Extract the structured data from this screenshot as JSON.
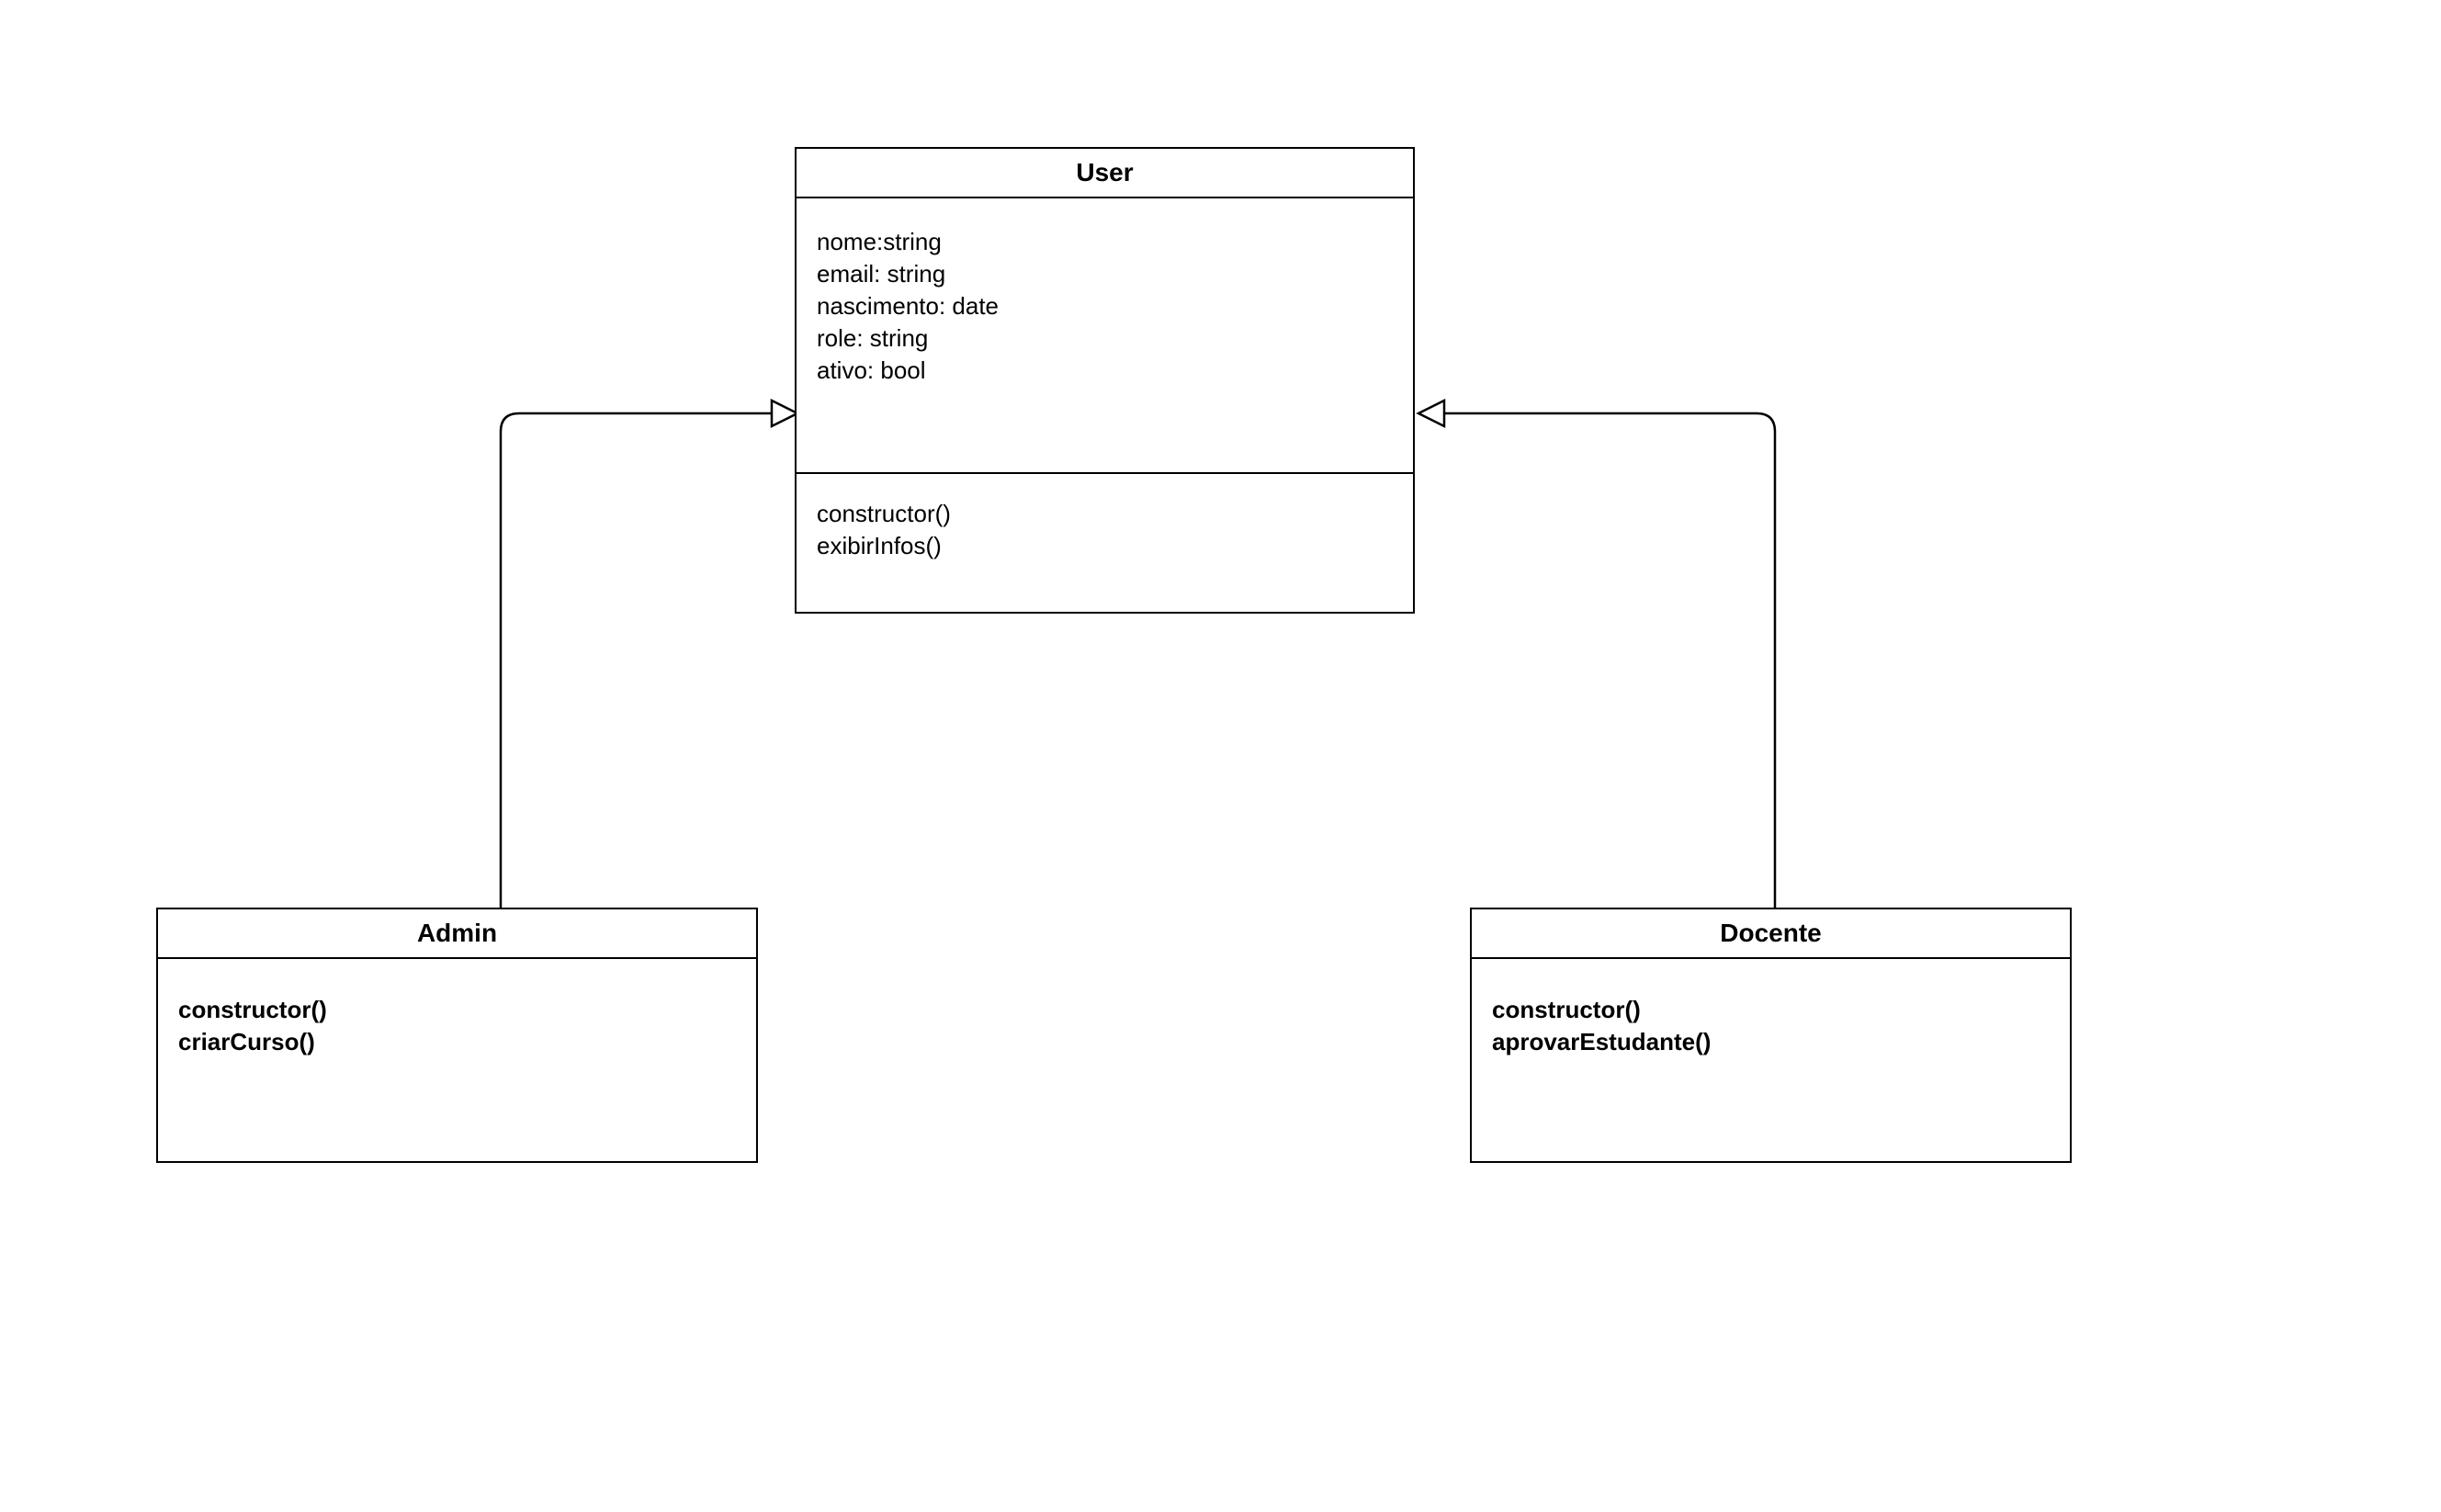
{
  "diagram": {
    "type": "uml-class-diagram",
    "classes": {
      "user": {
        "name": "User",
        "attributes": [
          "nome:string",
          "email: string",
          "nascimento: date",
          "role: string",
          "ativo: bool"
        ],
        "methods": [
          "constructor()",
          "exibirInfos()"
        ]
      },
      "admin": {
        "name": "Admin",
        "attributes": [],
        "methods": [
          "constructor()",
          "criarCurso()"
        ]
      },
      "docente": {
        "name": "Docente",
        "attributes": [],
        "methods": [
          "constructor()",
          "aprovarEstudante()"
        ]
      }
    },
    "relationships": [
      {
        "from": "admin",
        "to": "user",
        "type": "generalization"
      },
      {
        "from": "docente",
        "to": "user",
        "type": "generalization"
      }
    ]
  }
}
